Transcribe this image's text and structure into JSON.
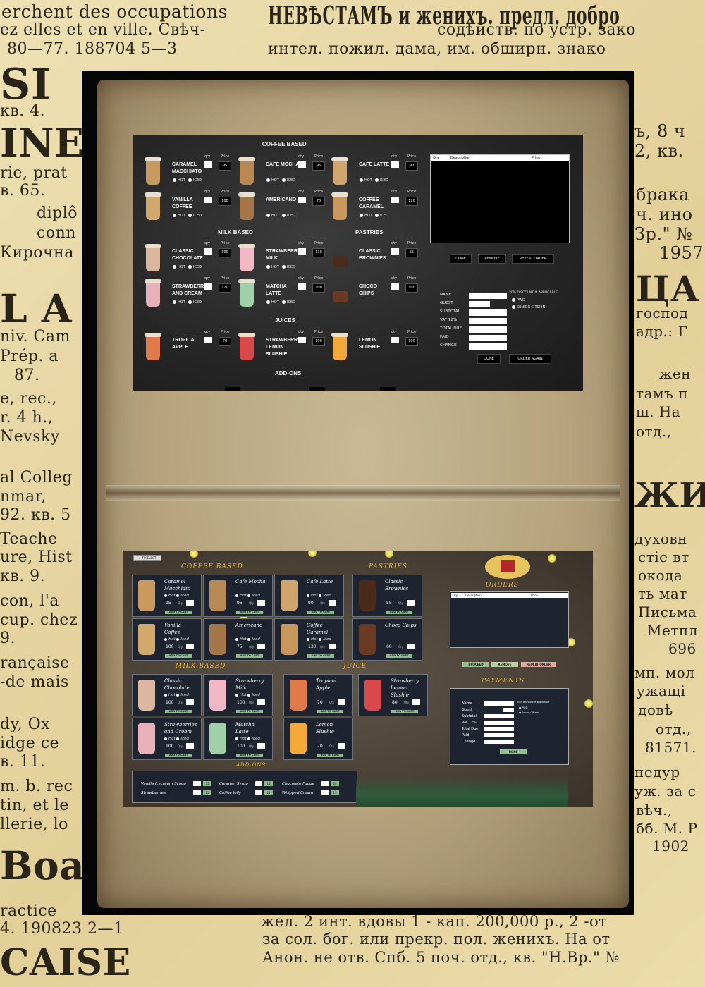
{
  "newspaper": {
    "lines": [
      "erchent des occupations",
      "ez elles et en ville. Свѣч-",
      "80—77.  188704 5—3",
      "НЕВѢСТАМЪ  и женихъ. предл. добро",
      "содѣйств. по устр. зако",
      "интел. пожил. дама, им. обширн. знако",
      "SI",
      "кв. 4.",
      "INE",
      "rie, prat",
      "в. 65.",
      "diplô",
      "conn",
      "Кирочна",
      "ъ, 8 ч",
      "2, кв.",
      "брака",
      "ч. ино",
      "Зр.\" №",
      "1957",
      "L A",
      "niv. Cam",
      "Prép. a",
      "87.",
      "e, rec.,",
      "r. 4 h.,",
      "Nevsky",
      "ЦА",
      "господ",
      "адр.: Г",
      "жен",
      "тамъ п",
      "ш. На",
      "отд.,",
      "al Colleg",
      "nmar,",
      "92. кв. 5",
      "Teache",
      "ure, Hist",
      "кв. 9.",
      "con, l'a",
      "cup. chez",
      "9.",
      "ЖИ",
      "духовн",
      "стіе вт",
      "окода",
      "ть мат",
      "Письма",
      "Метпл",
      "696",
      "rançaise",
      "-de mais",
      "dy, Ox",
      "idge ce",
      "в. 11.",
      "m. b. rec",
      "tin, et le",
      "llerie, lo",
      "Boar",
      "ractice",
      "4.  190823 2—1",
      "CAISE",
      "мп. мол",
      "ужащі",
      "довѣ",
      "отд.,",
      "81571.",
      "недур",
      "уж. за с",
      "вѣч.,",
      "бб. М. Р",
      "1902",
      "жел. 2 инт. вдовы 1 - кап. 200,000 р., 2 -от",
      "за сол. бог. или прекр. пол. женихъ. На от",
      "Анон. не отв. Спб. 5 поч. отд., кв. \"Н.Вр.\" №"
    ]
  },
  "top_app": {
    "sections": {
      "coffee": "COFFEE BASED",
      "milk": "MILK BASED",
      "pastries": "PASTRIES",
      "juices": "JUICES",
      "addons": "ADD-ONS"
    },
    "qty_label": "qty",
    "price_label": "Price",
    "hot_label": "HOT",
    "iced_label": "ICED",
    "items": [
      {
        "name": "CARAMEL MACCHIATO",
        "price": "95"
      },
      {
        "name": "CAFE MOCHA",
        "price": "95"
      },
      {
        "name": "CAFE LATTE",
        "price": "90"
      },
      {
        "name": "VANILLA COFFEE",
        "price": "100"
      },
      {
        "name": "AMERICANO",
        "price": "70"
      },
      {
        "name": "COFFEE CARAMEL",
        "price": "120"
      },
      {
        "name": "CLASSIC CHOCOLATE",
        "price": "100"
      },
      {
        "name": "STRAWBERRY MILK",
        "price": "110"
      },
      {
        "name": "CLASSIC BROWNIES",
        "price": "55"
      },
      {
        "name": "STRAWBERRIES AND CREAM",
        "price": "120"
      },
      {
        "name": "MATCHA LATTE",
        "price": "100"
      },
      {
        "name": "CHOCO CHIPS",
        "price": "100"
      },
      {
        "name": "TROPICAL APPLE",
        "price": "70"
      },
      {
        "name": "STRAWBERRY LEMON SLUSHIE",
        "price": "100"
      },
      {
        "name": "LEMON SLUSHIE",
        "price": "100"
      }
    ],
    "order_table": {
      "col_qty": "Qty",
      "col_desc": "Description",
      "col_price": "Price"
    },
    "buttons": {
      "done": "DONE",
      "remove": "REMOVE",
      "repeat": "REPEAT ORDER",
      "done2": "DONE",
      "order_again": "ORDER AGAIN"
    },
    "payment": {
      "name": "NAME",
      "guest": "GUEST",
      "subtotal": "SUBTOTAL",
      "vat": "VAT 12%",
      "total": "TOTAL DUE",
      "paid": "PAID",
      "change": "CHANGE",
      "discount": "20% DISCOUNT IF APPLICABLE",
      "pwd": "PWD",
      "senior": "SENIOR CITIZEN"
    }
  },
  "bottom_app": {
    "back": "← TI SELECT",
    "sections": {
      "coffee": "COFFEE BASED",
      "pastries": "PASTRIES",
      "orders": "ORDERS",
      "milk": "MILK BASED",
      "juice": "JUICE",
      "payments": "PAYMENTS",
      "addons": "ADD ONS"
    },
    "hot": "Hot",
    "iced": "Iced",
    "qty": "Qty",
    "add_to_cart": "ADD TO CART",
    "coffee": [
      {
        "n1": "Caramel",
        "n2": "Macchiato",
        "price": "95"
      },
      {
        "n1": "Cafe Mocha",
        "n2": "",
        "price": "95"
      },
      {
        "n1": "Cafe Latte",
        "n2": "",
        "price": "90"
      },
      {
        "n1": "Vanilla",
        "n2": "Coffee",
        "price": "100"
      },
      {
        "n1": "Americano",
        "n2": "",
        "price": "75"
      },
      {
        "n1": "Coffee",
        "n2": "Caramel",
        "price": "130"
      }
    ],
    "pastries": [
      {
        "n1": "Classic",
        "n2": "Brownies",
        "price": "55"
      },
      {
        "n1": "Choco Chips",
        "n2": "",
        "price": "60"
      }
    ],
    "milk": [
      {
        "n1": "Classic",
        "n2": "Chocolate",
        "price": "100"
      },
      {
        "n1": "Strawberry",
        "n2": "Milk",
        "price": "100"
      },
      {
        "n1": "Strawberries",
        "n2": "and Cream",
        "price": "100"
      },
      {
        "n1": "Matcha",
        "n2": "Latte",
        "price": "100"
      }
    ],
    "juice": [
      {
        "n1": "Tropical",
        "n2": "Apple",
        "price": "70"
      },
      {
        "n1": "Strawberry",
        "n2": "Lemon Slushie",
        "price": "80"
      },
      {
        "n1": "Lemon",
        "n2": "Slushie",
        "price": "70"
      }
    ],
    "order_table": {
      "col_qty": "Qty",
      "col_desc": "Description",
      "col_price": "Price"
    },
    "buttons": {
      "proceed": "PROCEED",
      "remove": "REMOVE",
      "repeat": "REPEAT ORDER",
      "done": "DONE"
    },
    "payment": {
      "name": "Name",
      "guest": "Guest",
      "subtotal": "Subtotal",
      "vat": "Vat 12%",
      "total": "Total Due",
      "paid": "Paid",
      "change": "Change",
      "discount": "20% discount if applicable",
      "pwd": "PWD",
      "senior": "Senior Citizen"
    },
    "addons": [
      {
        "name": "Vanilla Icecream Scoop",
        "price": "35"
      },
      {
        "name": "Strawberries",
        "price": "25"
      },
      {
        "name": "Caramel Syrup",
        "price": "15"
      },
      {
        "name": "Coffee Jelly",
        "price": "22"
      },
      {
        "name": "Chocolate Fudge",
        "price": "20"
      },
      {
        "name": "Whipped Cream",
        "price": "15"
      }
    ]
  }
}
